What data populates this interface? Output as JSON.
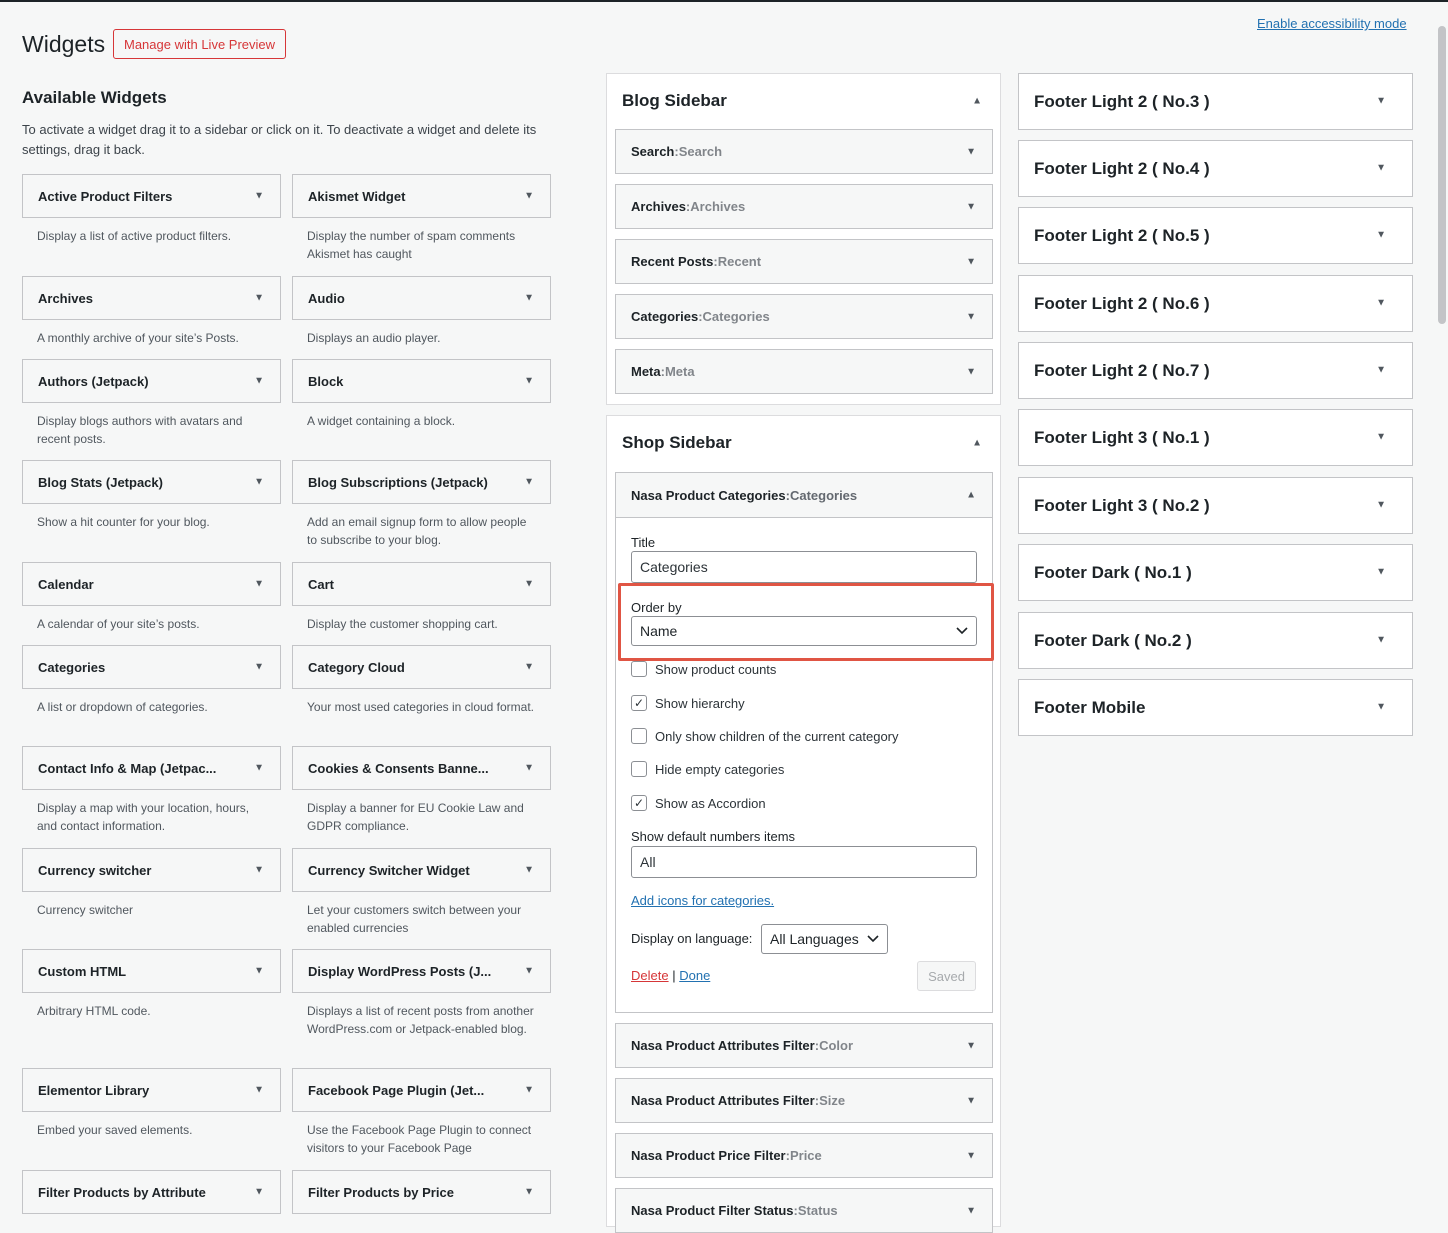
{
  "header": {
    "title": "Widgets",
    "live_preview_label": "Manage with Live Preview",
    "accessibility_link": "Enable accessibility mode"
  },
  "available": {
    "title": "Available Widgets",
    "description": "To activate a widget drag it to a sidebar or click on it. To deactivate a widget and delete its settings, drag it back.",
    "widgets": [
      {
        "name": "Active Product Filters",
        "desc": "Display a list of active product filters."
      },
      {
        "name": "Akismet Widget",
        "desc": "Display the number of spam comments Akismet has caught"
      },
      {
        "name": "Archives",
        "desc": "A monthly archive of your site’s Posts."
      },
      {
        "name": "Audio",
        "desc": "Displays an audio player."
      },
      {
        "name": "Authors (Jetpack)",
        "desc": "Display blogs authors with avatars and recent posts."
      },
      {
        "name": "Block",
        "desc": "A widget containing a block."
      },
      {
        "name": "Blog Stats (Jetpack)",
        "desc": "Show a hit counter for your blog."
      },
      {
        "name": "Blog Subscriptions (Jetpack)",
        "desc": "Add an email signup form to allow peo­ple to subscribe to your blog."
      },
      {
        "name": "Calendar",
        "desc": "A calendar of your site’s posts."
      },
      {
        "name": "Cart",
        "desc": "Display the customer shopping cart."
      },
      {
        "name": "Categories",
        "desc": "A list or dropdown of categories."
      },
      {
        "name": "Category Cloud",
        "desc": "Your most used categories in cloud format."
      },
      {
        "name": "Contact Info & Map (Jetpac...",
        "desc": "Display a map with your location, hours, and contact information."
      },
      {
        "name": "Cookies & Consents Banne...",
        "desc": "Display a banner for EU Cookie Law and GDPR compliance."
      },
      {
        "name": "Currency switcher",
        "desc": "Currency switcher"
      },
      {
        "name": "Currency Switcher Widget",
        "desc": "Let your customers switch between your enabled currencies"
      },
      {
        "name": "Custom HTML",
        "desc": "Arbitrary HTML code."
      },
      {
        "name": "Display WordPress Posts (J...",
        "desc": "Displays a list of recent posts from an­other WordPress.com or Jetpack-en­abled blog."
      },
      {
        "name": "Elementor Library",
        "desc": "Embed your saved elements."
      },
      {
        "name": "Facebook Page Plugin (Jet...",
        "desc": "Use the Facebook Page Plugin to con­nect visitors to your Facebook Page"
      },
      {
        "name": "Filter Products by Attribute",
        "desc": ""
      },
      {
        "name": "Filter Products by Price",
        "desc": ""
      }
    ]
  },
  "blog_sidebar": {
    "title": "Blog Sidebar",
    "items": [
      {
        "type": "Search",
        "sep": ": ",
        "title": "Search"
      },
      {
        "type": "Archives",
        "sep": ": ",
        "title": "Archives"
      },
      {
        "type": "Recent Posts",
        "sep": ": ",
        "title": "Recent"
      },
      {
        "type": "Categories",
        "sep": ": ",
        "title": "Categories"
      },
      {
        "type": "Meta",
        "sep": ": ",
        "title": "Meta"
      }
    ]
  },
  "shop_sidebar": {
    "title": "Shop Sidebar",
    "open_widget": {
      "type": "Nasa Product Categories",
      "sep": ": ",
      "title": "Categories",
      "title_label": "Title",
      "title_value": "Categories",
      "order_label": "Order by",
      "order_value": "Name",
      "checkboxes": [
        {
          "label": "Show product counts",
          "checked": false
        },
        {
          "label": "Show hierarchy",
          "checked": true
        },
        {
          "label": "Only show children of the current category",
          "checked": false
        },
        {
          "label": "Hide empty categories",
          "checked": false
        },
        {
          "label": "Show as Accordion",
          "checked": true
        }
      ],
      "default_items_label": "Show default numbers items",
      "default_items_value": "All",
      "icons_link": "Add icons for categories.",
      "language_label": "Display on language:",
      "language_value": "All Languages",
      "delete_label": "Delete",
      "separator": "|",
      "done_label": "Done",
      "saved_label": "Saved"
    },
    "items": [
      {
        "type": "Nasa Product Attributes Filter",
        "sep": ": ",
        "title": "Color"
      },
      {
        "type": "Nasa Product Attributes Filter",
        "sep": ": ",
        "title": "Size"
      },
      {
        "type": "Nasa Product Price Filter",
        "sep": ": ",
        "title": "Price"
      },
      {
        "type": "Nasa Product Filter Status",
        "sep": ": ",
        "title": "Status"
      }
    ]
  },
  "footer_sidebars": [
    "Footer Light 2 ( No.3 )",
    "Footer Light 2 ( No.4 )",
    "Footer Light 2 ( No.5 )",
    "Footer Light 2 ( No.6 )",
    "Footer Light 2 ( No.7 )",
    "Footer Light 3 ( No.1 )",
    "Footer Light 3 ( No.2 )",
    "Footer Dark ( No.1 )",
    "Footer Dark ( No.2 )",
    "Footer Mobile"
  ],
  "icons": {
    "collapse": "▲",
    "expand": "▼",
    "chevron": "chevron-down-icon",
    "check": "✓"
  },
  "colors": {
    "link": "#2271b1",
    "delete": "#d63638",
    "highlight": "#e05544"
  }
}
